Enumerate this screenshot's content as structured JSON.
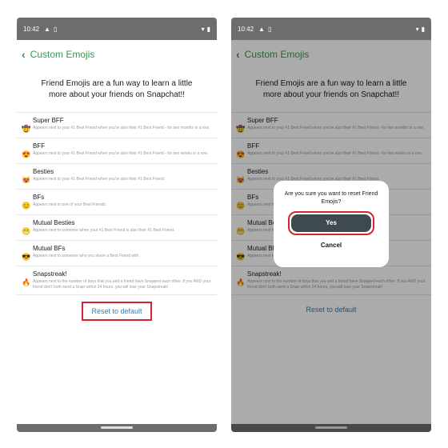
{
  "status": {
    "time": "10:42"
  },
  "header": {
    "title": "Custom Emojis"
  },
  "intro": "Friend Emojis are a fun way to learn a little more about your friends on Snapchat!!",
  "items": [
    {
      "emoji": "🤠",
      "name": "Super BFF",
      "desc": "Appears next to your #1 Best Friend when you're also their #1 Best Friend - for two months in a row."
    },
    {
      "emoji": "😍",
      "name": "BFF",
      "desc": "Appears next to your #1 Best Friend when you're also their #1 Best Friend - for two weeks in a row."
    },
    {
      "emoji": "😻",
      "name": "Besties",
      "desc": "Appears next to your #1 Best Friend when you're also their #1 Best Friend."
    },
    {
      "emoji": "😊",
      "name": "BFs",
      "desc": "Appears next to one of your Best Friends."
    },
    {
      "emoji": "😬",
      "name": "Mutual Besties",
      "desc": "Appears next to someone when your #1 Best Friend is also their #1 Best Friend."
    },
    {
      "emoji": "😎",
      "name": "Mutual BFs",
      "desc": "Appears next to someone who you share a Best Friend with."
    },
    {
      "emoji": "🔥",
      "name": "Snapstreak!",
      "desc": "Appears next to the number of days that you and a friend have Snapped each other. If you AND your friend don't both send a Snap within 24 hours, you will lose your Snapstreak!"
    }
  ],
  "reset_label": "Reset to default",
  "dialog": {
    "question": "Are you sure you want to reset Friend Emojis?",
    "yes": "Yes",
    "cancel": "Cancel"
  },
  "colors": {
    "accent": "#2e9b46",
    "link": "#1f86c6",
    "highlight": "#d5232f"
  }
}
